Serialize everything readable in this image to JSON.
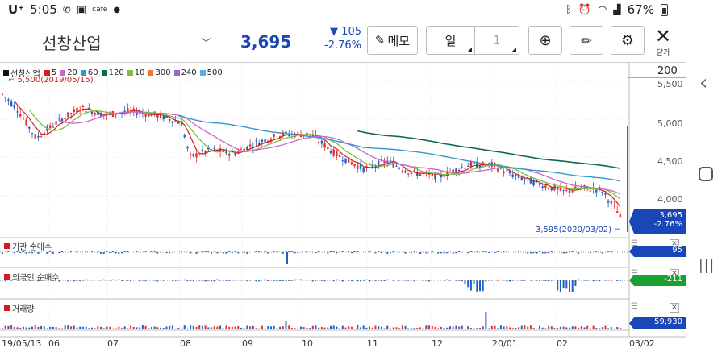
{
  "status": {
    "carrier": "U⁺",
    "time": "5:05",
    "battery": "67%"
  },
  "stock": {
    "name": "선창산업",
    "price": "3,695",
    "change": "105",
    "change_pct": "-2.76%"
  },
  "toolbar": {
    "memo": "메모",
    "period": "일",
    "period_num": "1",
    "close_label": "닫기"
  },
  "legend": {
    "stock_name": "선창산업",
    "mas": [
      {
        "label": "5",
        "color": "#d11d1d"
      },
      {
        "label": "20",
        "color": "#cc66cc"
      },
      {
        "label": "60",
        "color": "#3399cc"
      },
      {
        "label": "120",
        "color": "#0a6b58"
      },
      {
        "label": "10",
        "color": "#7bc043"
      },
      {
        "label": "300",
        "color": "#f07a2a"
      },
      {
        "label": "240",
        "color": "#9966cc"
      },
      {
        "label": "500",
        "color": "#5aaee0"
      }
    ],
    "high_label": "5,500(2019/05/15)",
    "low_label": "3,595(2020/03/02)"
  },
  "price_axis": {
    "zoom": "200",
    "ticks": [
      "5,500",
      "5,000",
      "4,500",
      "4,000"
    ],
    "current": "3,695",
    "current_pct": "-2.76%"
  },
  "panels": [
    {
      "title": "기관 순매수",
      "value": "95",
      "value_color": "#1a5ccc"
    },
    {
      "title": "외국인 순매수",
      "value": "-211",
      "value_color": "#19a030"
    },
    {
      "title": "거래량",
      "value": "59,930",
      "value_color": "#1a5ccc"
    }
  ],
  "date_axis": [
    "19/05/13",
    "06",
    "07",
    "08",
    "09",
    "10",
    "11",
    "12",
    "20/01",
    "02",
    "03/02"
  ],
  "colors": {
    "up": "#e03030",
    "down": "#2060c0",
    "price_text": "#1a47b8"
  }
}
